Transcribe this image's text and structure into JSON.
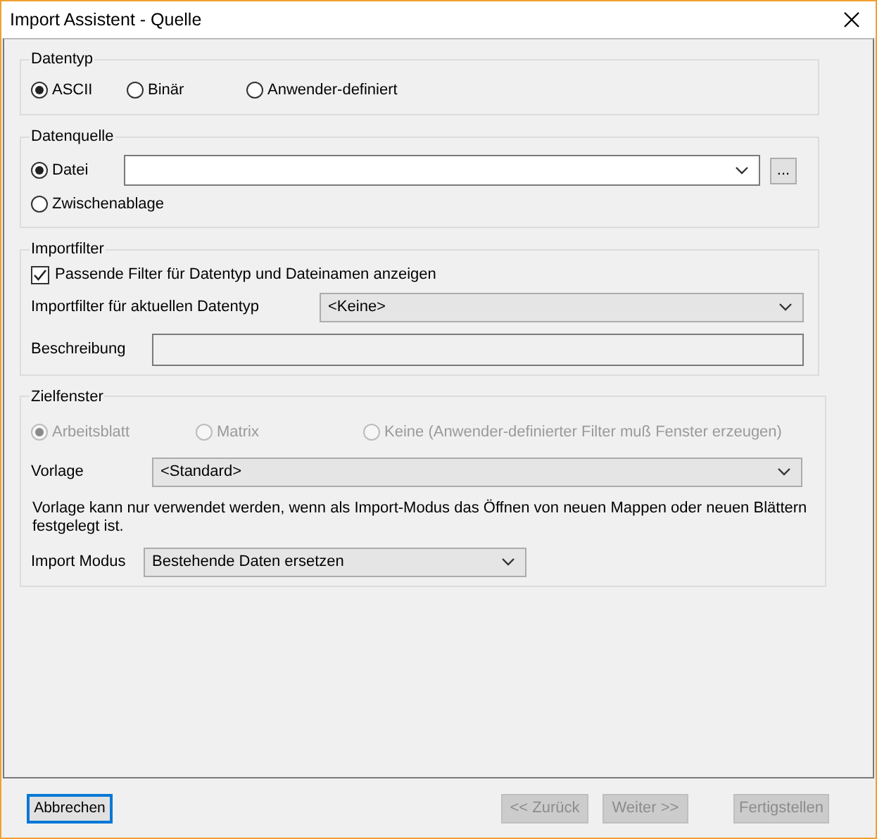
{
  "window": {
    "title": "Import Assistent - Quelle"
  },
  "datentyp": {
    "legend": "Datentyp",
    "options": [
      {
        "label": "ASCII",
        "selected": true
      },
      {
        "label": "Binär",
        "selected": false
      },
      {
        "label": "Anwender-definiert",
        "selected": false
      }
    ]
  },
  "datenquelle": {
    "legend": "Datenquelle",
    "options": [
      {
        "label": "Datei",
        "selected": true
      },
      {
        "label": "Zwischenablage",
        "selected": false
      }
    ],
    "browse_button": "..."
  },
  "importfilter": {
    "legend": "Importfilter",
    "checkbox": {
      "label": "Passende Filter für Datentyp und Dateinamen anzeigen",
      "checked": true
    },
    "filter_label": "Importfilter für aktuellen Datentyp",
    "filter_value": "<Keine>",
    "description_label": "Beschreibung"
  },
  "zielfenster": {
    "legend": "Zielfenster",
    "disabled": true,
    "options": [
      {
        "label": "Arbeitsblatt",
        "selected": true
      },
      {
        "label": "Matrix",
        "selected": false
      },
      {
        "label": "Keine (Anwender-definierter Filter muß Fenster erzeugen)",
        "selected": false
      }
    ],
    "template_label": "Vorlage",
    "template_value": "<Standard>",
    "note": "Vorlage kann nur verwendet werden, wenn als Import-Modus das Öffnen von neuen Mappen oder neuen Blättern festgelegt ist.",
    "mode_label": "Import Modus",
    "mode_value": "Bestehende Daten ersetzen"
  },
  "buttons": [
    {
      "label": "Abbrechen",
      "disabled": false,
      "focused": true
    },
    {
      "label": "<< Zurück",
      "disabled": true,
      "focused": false
    },
    {
      "label": "Weiter >>",
      "disabled": true,
      "focused": false
    },
    {
      "label": "Fertigstellen",
      "disabled": true,
      "focused": false
    }
  ]
}
